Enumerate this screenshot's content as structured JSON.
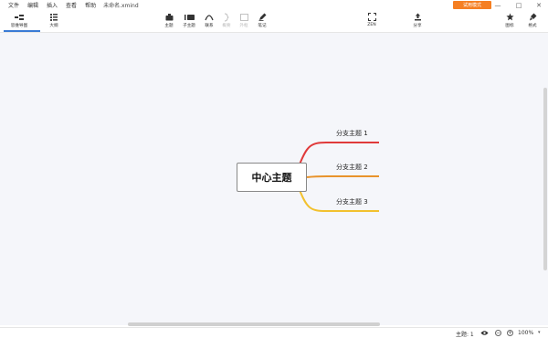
{
  "menu": {
    "items": [
      "文件",
      "编辑",
      "插入",
      "查看",
      "帮助"
    ],
    "filename": "未命名.xmind",
    "trial_label": "试用模式"
  },
  "window_controls": {
    "minimize": "—",
    "maximize": "□",
    "close": "✕"
  },
  "toolbar": {
    "mindmap_tab": "思维导图",
    "outline_tab": "大纲",
    "topic": "主题",
    "subtopic": "子主题",
    "relationship": "联系",
    "summary": "概要",
    "boundary": "外框",
    "note": "笔记",
    "zen": "ZEN",
    "share": "分享",
    "icon_panel": "图标",
    "format_panel": "格式"
  },
  "map": {
    "central_topic": "中心主题",
    "branches": [
      {
        "label": "分支主题 1",
        "color": "#e03a3a"
      },
      {
        "label": "分支主题 2",
        "color": "#e8932b"
      },
      {
        "label": "分支主题 3",
        "color": "#f2c12e"
      }
    ]
  },
  "status": {
    "topics_count": "主题: 1",
    "zoom_level": "100%",
    "zoom_out": "−",
    "zoom_in": "+",
    "zoom_caret": "▾"
  },
  "colors": {
    "accent": "#3a7bd5",
    "trial": "#f57f22",
    "canvas_bg": "#f5f6fa"
  }
}
